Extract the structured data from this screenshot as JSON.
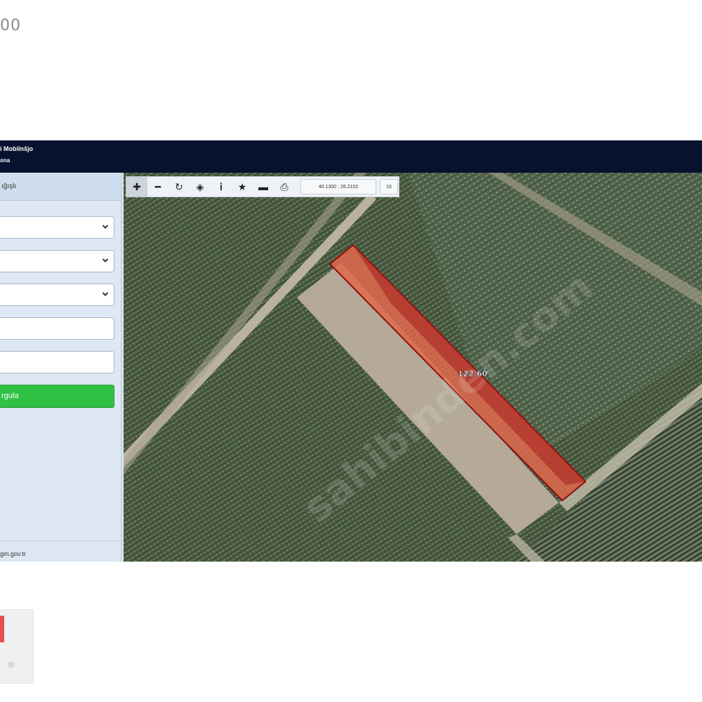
{
  "page": {
    "top_number": "00"
  },
  "header": {
    "title_line1": "i Mobilnšjo",
    "title_line2": "ona"
  },
  "sidebar": {
    "panel_title": "ığışlı",
    "fields": [
      {
        "type": "select",
        "value": ""
      },
      {
        "type": "select",
        "value": ""
      },
      {
        "type": "select",
        "value": ""
      },
      {
        "type": "text",
        "value": ""
      },
      {
        "type": "text",
        "value": ""
      }
    ],
    "query_button_label": "rgula",
    "footer_link": "gm.gov.tr"
  },
  "toolbar": {
    "coords": "40.1300 : 28.2102",
    "zoom": "16",
    "tools": [
      "plus-icon",
      "minus-icon",
      "refresh-icon",
      "locate-icon",
      "info-icon",
      "star-icon",
      "measure-icon",
      "print-icon"
    ]
  },
  "map": {
    "parcel_label": "122/60",
    "watermark": "sahibinden.com",
    "parcel_color": "#e0684c"
  }
}
